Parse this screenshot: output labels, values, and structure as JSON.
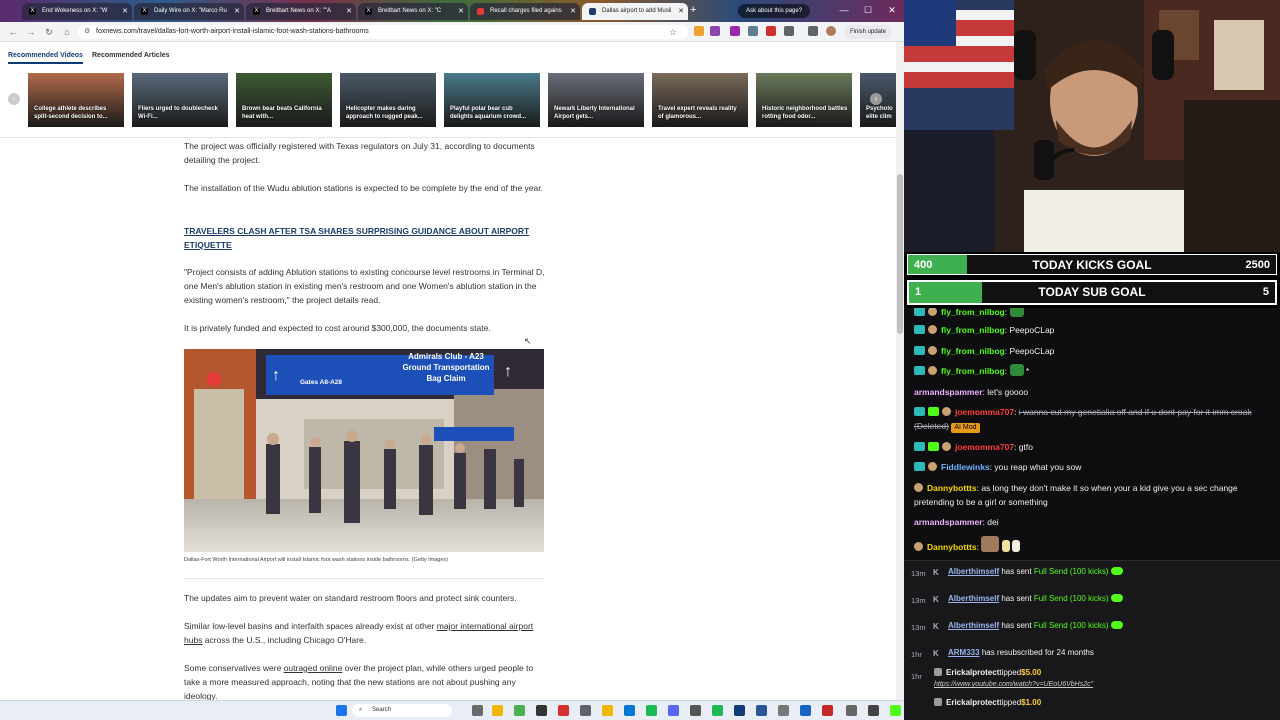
{
  "browser": {
    "tabs": [
      {
        "label": "End Wokeness on X: \"W"
      },
      {
        "label": "Daily Wire on X: \"Marco Ru"
      },
      {
        "label": "Breitbart News on X: \"\"A"
      },
      {
        "label": "Breitbart News on X: \"C"
      },
      {
        "label": "Recall charges filed agains"
      },
      {
        "label": "Dallas airport to add Musli"
      }
    ],
    "ask_button": "Ask about this page?",
    "url": "foxnews.com/travel/dallas-fort-worth-airport-install-islamic-foot-wash-stations-bathrooms",
    "finish_update": "Finish update"
  },
  "recommended": {
    "tabs": [
      "Recommended Videos",
      "Recommended Articles"
    ],
    "videos": [
      {
        "caption": "College athlete describes split-second decision to...",
        "color": "#b06a4a"
      },
      {
        "caption": "Fliers urged to doublecheck Wi-Fi...",
        "color": "#5a6a7a"
      },
      {
        "caption": "Brown bear beats California heat with...",
        "color": "#3f5a34"
      },
      {
        "caption": "Helicopter makes daring approach to rugged peak...",
        "color": "#4b5a68"
      },
      {
        "caption": "Playful polar bear cub delights aquarium crowd...",
        "color": "#4a7a8a"
      },
      {
        "caption": "Newark Liberty International Airport gets...",
        "color": "#6a6e78"
      },
      {
        "caption": "Travel expert reveals reality of glamorous...",
        "color": "#7a6a5a"
      },
      {
        "caption": "Historic neighborhood battles rotting food odor...",
        "color": "#6a7a5a"
      },
      {
        "caption": "Psycholo elite clim",
        "color": "#4a5a6a"
      }
    ]
  },
  "article": {
    "p1": "The project was officially registered with Texas regulators on July 31, according to documents detailing the project.",
    "p2": "The installation of the Wudu ablution stations is expected to be complete by the end of the year.",
    "headline_link": "TRAVELERS CLASH AFTER TSA SHARES SURPRISING GUIDANCE ABOUT AIRPORT ETIQUETTE",
    "p3": "\"Project consists of adding Ablution stations to existing concourse level restrooms in Terminal D, one Men's ablution station in existing men's restroom and one Women's ablution station in the existing women's restroom,\" the project details read.",
    "p4": "It is privately funded and expected to cost around $300,000, the documents state.",
    "photo_signs": {
      "line1": "Admirals Club - A23",
      "line2": "Ground Transportation",
      "line3": "Bag Claim",
      "gates": "Gates A8-A28"
    },
    "caption": "Dallas-Fort Worth International Airport will install Islamic foot wash stations inside bathrooms. (Getty Images)",
    "p5": "The updates aim to prevent water on standard restroom floors and protect sink counters.",
    "p6_pre": "Similar low-level basins and interfaith spaces already exist at other ",
    "p6_link": "major international airport hubs",
    "p6_post": " across the U.S., including Chicago O'Hare.",
    "p7_pre": "Some conservatives were ",
    "p7_link": "outraged online",
    "p7_post": " over the project plan, while others urged people to take a more measured approach, noting that the new stations are not about pushing any ideology."
  },
  "taskbar": {
    "search_label": "Search"
  },
  "goals": {
    "kicks": {
      "current": "400",
      "label": "TODAY KICKS GOAL",
      "target": "2500",
      "progress": 0.16
    },
    "subs": {
      "current": "1",
      "label": "TODAY SUB GOAL",
      "target": "5",
      "progress": 0.2
    }
  },
  "chat": [
    {
      "user": "fly_from_nilbog",
      "text": "",
      "user_color": "#53fc18"
    },
    {
      "user": "fly_from_nilbog",
      "text": "PeepoCLap",
      "user_color": "#53fc18"
    },
    {
      "user": "fly_from_nilbog",
      "text": "PeepoCLap",
      "user_color": "#53fc18"
    },
    {
      "user": "fly_from_nilbog",
      "text": "*",
      "user_color": "#53fc18"
    },
    {
      "user": "armandspammer",
      "text": "let's goooo",
      "user_color": "#efb2ff"
    },
    {
      "user": "joemomma707",
      "text": "i wanna cut my genetialia off and if u dont pay for it imm croak (Deleted)",
      "user_color": "#ff3b3b",
      "badge": "AI Mod"
    },
    {
      "user": "joemomma707",
      "text": "gtfo",
      "user_color": "#ff3b3b"
    },
    {
      "user": "Fiddlewinks",
      "text": "you reap what you sow",
      "user_color": "#6fb4ff"
    },
    {
      "user": "Dannybottts",
      "text": "as long they don't make it so when your a kid give you a sec change pretending to be a girl or something",
      "user_color": "#f5d800"
    },
    {
      "user": "armandspammer",
      "text": "dei",
      "user_color": "#efb2ff"
    },
    {
      "user": "Dannybottts",
      "text": "",
      "user_color": "#f5d800"
    }
  ],
  "events": [
    {
      "time": "13m",
      "user": "Alberthimself",
      "action": "has sent",
      "gift": "Full Send (100 kicks)"
    },
    {
      "time": "13m",
      "user": "Alberthimself",
      "action": "has sent",
      "gift": "Full Send (100 kicks)"
    },
    {
      "time": "13m",
      "user": "Alberthimself",
      "action": "has sent",
      "gift": "Full Send (100 kicks)"
    },
    {
      "time": "1hr",
      "user": "ARM333",
      "action": "has resubscribed for 24 months",
      "gift": ""
    }
  ],
  "tips": [
    {
      "time": "1hr",
      "user": "Erickalprotect",
      "action": "tipped",
      "amount": "$5.00",
      "message": "https://www.youtube.com/watch?v=UEoU6VbHs2c\""
    },
    {
      "time": "",
      "user": "Erickalprotect",
      "action": "tipped",
      "amount": "$1.00",
      "message": ""
    }
  ]
}
